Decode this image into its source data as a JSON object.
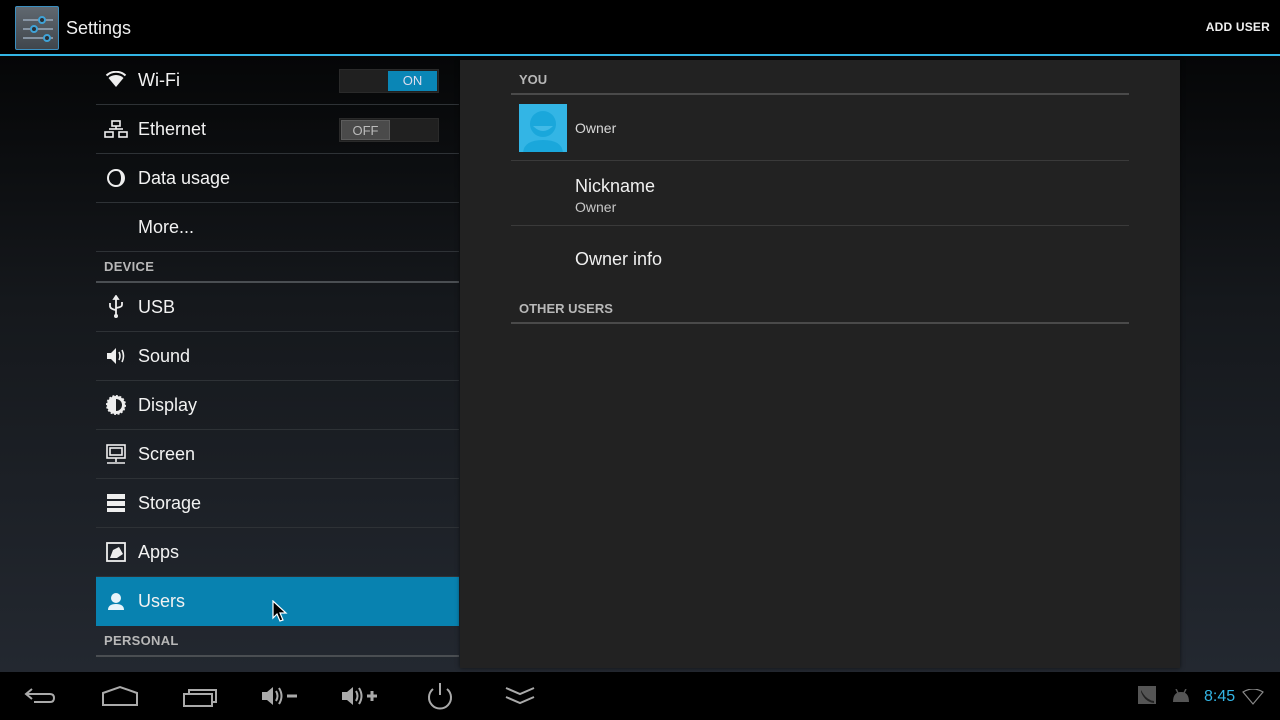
{
  "actionbar": {
    "title": "Settings",
    "app_icon": "settings-sliders-icon",
    "add_user_label": "ADD USER",
    "accent_color": "#33b5e5"
  },
  "sidebar": {
    "items": [
      {
        "type": "item",
        "label": "Wi-Fi",
        "icon": "wifi-icon",
        "toggle": "ON"
      },
      {
        "type": "item",
        "label": "Ethernet",
        "icon": "ethernet-icon",
        "toggle": "OFF"
      },
      {
        "type": "item",
        "label": "Data usage",
        "icon": "data-usage-icon"
      },
      {
        "type": "item",
        "label": "More...",
        "icon": null
      },
      {
        "type": "header",
        "label": "DEVICE"
      },
      {
        "type": "item",
        "label": "USB",
        "icon": "usb-icon"
      },
      {
        "type": "item",
        "label": "Sound",
        "icon": "sound-icon"
      },
      {
        "type": "item",
        "label": "Display",
        "icon": "display-brightness-icon"
      },
      {
        "type": "item",
        "label": "Screen",
        "icon": "screen-monitor-icon"
      },
      {
        "type": "item",
        "label": "Storage",
        "icon": "storage-icon"
      },
      {
        "type": "item",
        "label": "Apps",
        "icon": "apps-icon"
      },
      {
        "type": "item",
        "label": "Users",
        "icon": "user-icon",
        "selected": true
      },
      {
        "type": "header",
        "label": "PERSONAL"
      }
    ],
    "selected_color": "#0882b0"
  },
  "users_panel": {
    "you_header": "YOU",
    "owner_name": "Owner",
    "nickname_title": "Nickname",
    "nickname_value": "Owner",
    "owner_info_title": "Owner info",
    "other_users_header": "OTHER USERS"
  },
  "navbar": {
    "buttons": [
      "back-icon",
      "home-icon",
      "recent-apps-icon",
      "volume-down-icon",
      "volume-up-icon",
      "power-icon",
      "collapse-icon"
    ],
    "clock": "8:45",
    "status_icons": [
      "screenshot-icon",
      "android-debug-icon",
      "wifi-signal-icon"
    ]
  }
}
